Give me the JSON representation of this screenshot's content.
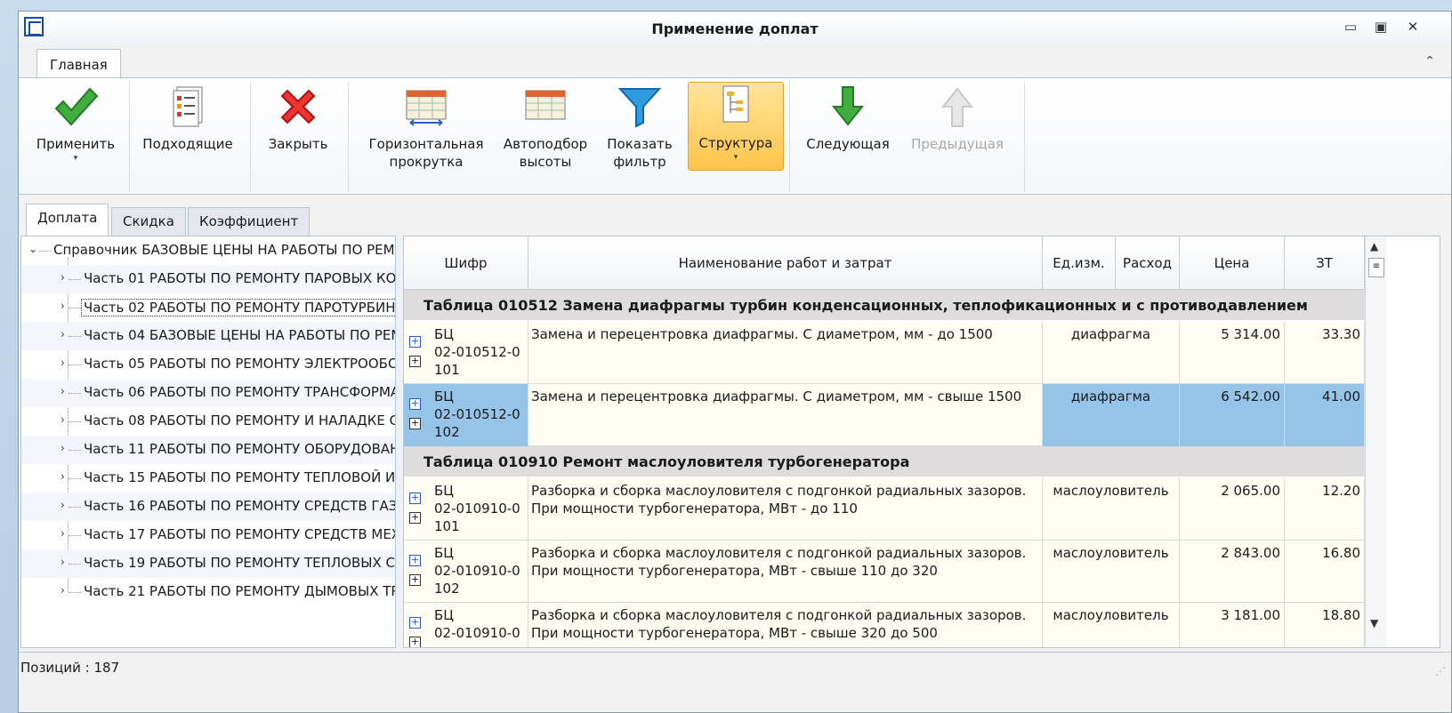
{
  "window": {
    "title": "Применение доплат",
    "min_glyph": "▭",
    "max_glyph": "▣",
    "close_glyph": "✕"
  },
  "ribbon": {
    "tab_label": "Главная",
    "collapse_glyph": "⌃",
    "buttons": [
      {
        "label1": "Применить",
        "label2": ""
      },
      {
        "label1": "Подходящие",
        "label2": ""
      },
      {
        "label1": "Закрыть",
        "label2": ""
      },
      {
        "label1": "Горизонтальная",
        "label2": "прокрутка"
      },
      {
        "label1": "Автоподбор",
        "label2": "высоты"
      },
      {
        "label1": "Показать",
        "label2": "фильтр"
      },
      {
        "label1": "Структура",
        "label2": ""
      },
      {
        "label1": "Следующая",
        "label2": ""
      },
      {
        "label1": "Предыдущая",
        "label2": ""
      }
    ],
    "dropdown_glyph": "▾"
  },
  "left_tabs": [
    "Доплата",
    "Скидка",
    "Коэффициент"
  ],
  "tree": {
    "root": "Справочник  БАЗОВЫЕ ЦЕНЫ НА РАБОТЫ ПО РЕМ",
    "items": [
      "Часть 01 РАБОТЫ ПО РЕМОНТУ ПАРОВЫХ КО",
      "Часть 02 РАБОТЫ ПО РЕМОНТУ ПАРОТУРБИН",
      "Часть 04 БАЗОВЫЕ ЦЕНЫ НА РАБОТЫ ПО РЕМ",
      "Часть 05 РАБОТЫ ПО РЕМОНТУ ЭЛЕКТРООБС",
      "Часть 06 РАБОТЫ ПО РЕМОНТУ ТРАНСФОРМА",
      "Часть 08 РАБОТЫ ПО РЕМОНТУ И НАЛАДКЕ С",
      "Часть 11 РАБОТЫ ПО РЕМОНТУ ОБОРУДОВАН",
      "Часть 15 РАБОТЫ ПО РЕМОНТУ ТЕПЛОВОЙ И:",
      "Часть 16 РАБОТЫ ПО РЕМОНТУ СРЕДСТВ ГАЗ",
      "Часть 17 РАБОТЫ ПО РЕМОНТУ СРЕДСТВ МЕХ",
      "Часть 19 РАБОТЫ ПО РЕМОНТУ ТЕПЛОВЫХ СЕ",
      "Часть 21 РАБОТЫ ПО РЕМОНТУ ДЫМОВЫХ ТР"
    ]
  },
  "grid": {
    "columns": [
      "Шифр",
      "Наименование работ и затрат",
      "Ед.изм.",
      "Расход",
      "Цена",
      "ЗТ"
    ],
    "groups": [
      "Таблица 010512 Замена диафрагмы турбин конденсационных, теплофикационных и с противодавлением",
      "Таблица 010910 Ремонт маслоуловителя турбогенератора"
    ],
    "rows": [
      {
        "code1": "БЦ",
        "code2": "02-010512-0",
        "code3": "101",
        "name1": "Замена и перецентровка диафрагмы. С диаметром, мм - до 1500",
        "name2": "",
        "unit": "диафрагма",
        "usage": "",
        "price": "5 314.00",
        "zt": "33.30"
      },
      {
        "code1": "БЦ",
        "code2": "02-010512-0",
        "code3": "102",
        "name1": "Замена и перецентровка диафрагмы. С диаметром, мм - свыше 1500",
        "name2": "",
        "unit": "диафрагма",
        "usage": "",
        "price": "6 542.00",
        "zt": "41.00"
      },
      {
        "code1": "БЦ",
        "code2": "02-010910-0",
        "code3": "101",
        "name1": "Разборка и сборка маслоуловителя с подгонкой радиальных зазоров.",
        "name2": "При мощности турбогенератора, МВт - до 110",
        "unit": "маслоуловитель",
        "usage": "",
        "price": "2 065.00",
        "zt": "12.20"
      },
      {
        "code1": "БЦ",
        "code2": "02-010910-0",
        "code3": "102",
        "name1": "Разборка и сборка маслоуловителя с подгонкой радиальных зазоров.",
        "name2": "При мощности турбогенератора, МВт - свыше 110 до 320",
        "unit": "маслоуловитель",
        "usage": "",
        "price": "2 843.00",
        "zt": "16.80"
      },
      {
        "code1": "БЦ",
        "code2": "02-010910-0",
        "code3": "",
        "name1": "Разборка и сборка маслоуловителя с подгонкой радиальных зазоров.",
        "name2": "При мощности турбогенератора, МВт - свыше 320 до 500",
        "unit": "маслоуловитель",
        "usage": "",
        "price": "3 181.00",
        "zt": "18.80"
      }
    ],
    "selected_row": 1
  },
  "status": {
    "text": "Позиций : 187"
  },
  "colors": {
    "selection": "#96c3e8",
    "active_button": "#ffc44a",
    "group_row": "#dedcdc"
  }
}
